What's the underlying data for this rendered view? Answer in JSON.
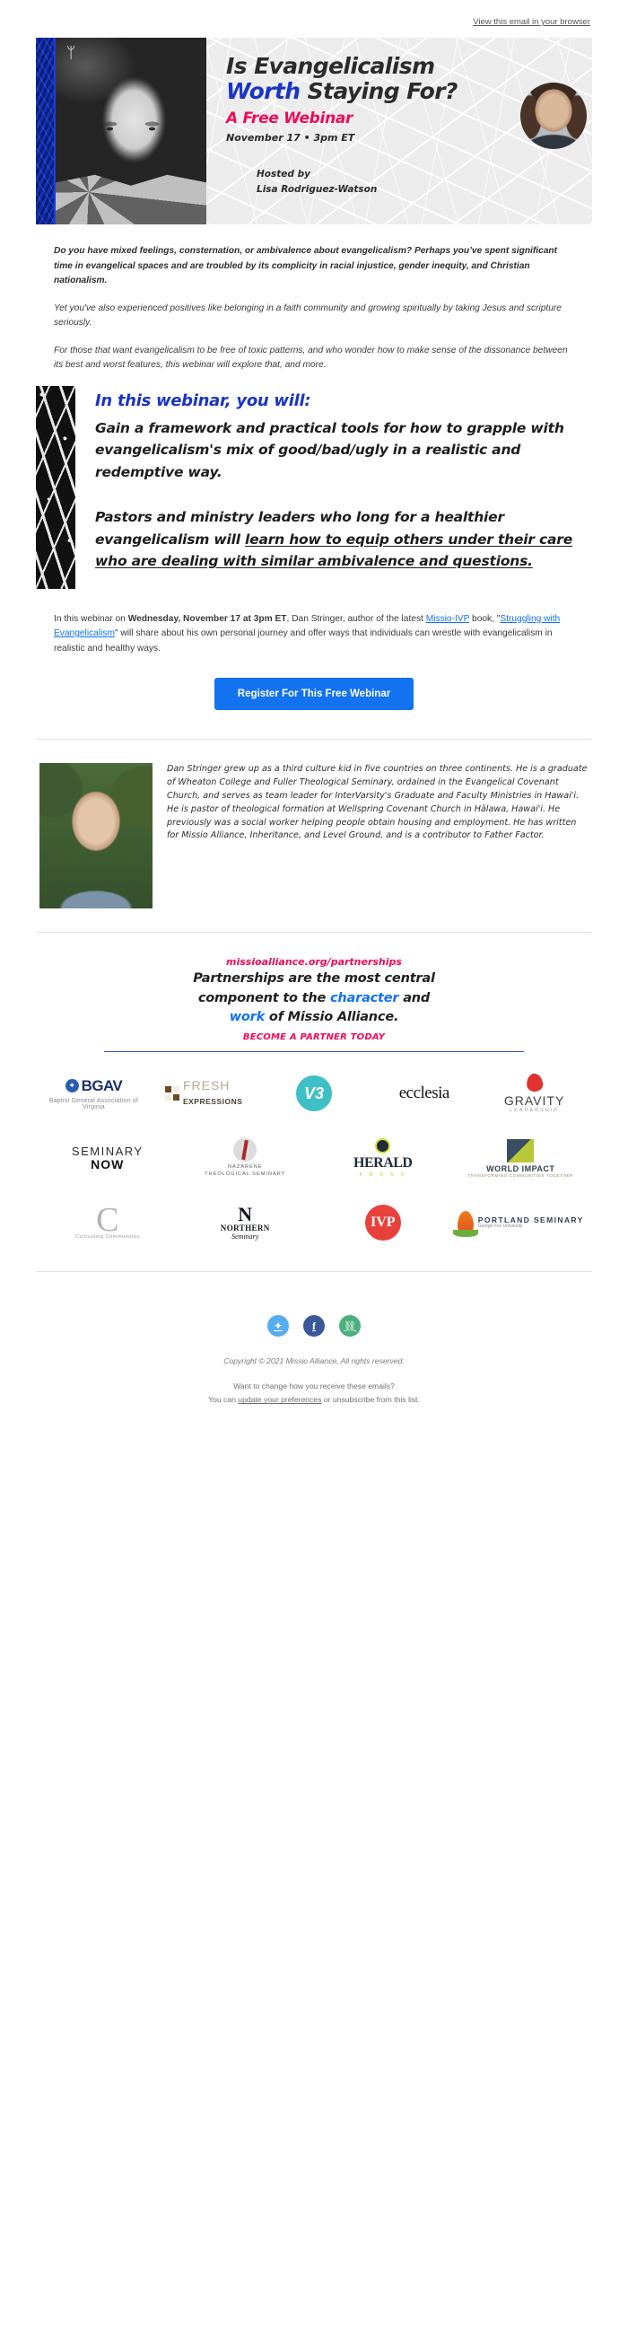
{
  "preheader": {
    "view_in_browser": "View this email in your browser"
  },
  "hero": {
    "logo_glyph": "ᛘ",
    "title_line1": "Is Evangelicalism",
    "title_worth": "Worth",
    "title_rest": " Staying For?",
    "subtitle": "A Free Webinar",
    "date": "November 17 • 3pm ET",
    "hosted_by_label": "Hosted by",
    "host_name": "Lisa Rodriguez-Watson",
    "colors": {
      "blue": "#1a35c4",
      "pink": "#ee0a5a",
      "dark": "#2b2b2b"
    }
  },
  "intro": {
    "p1": "Do you have mixed feelings, consternation, or ambivalence about evangelicalism? Perhaps you’ve spent significant time in evangelical spaces and are troubled by its complicity in racial injustice, gender inequity, and Christian nationalism.",
    "p2": "Yet you've also experienced positives like belonging in a faith community and growing spiritually by taking Jesus and scripture seriously.",
    "p3": "For those that want evangelicalism to be free of toxic patterns, and who wonder how to make sense of the dissonance between its best and worst features, this webinar will explore that, and more."
  },
  "highlight": {
    "title": "In this webinar, you will:",
    "p1": "Gain a framework and practical tools for how to grapple with evangelicalism's mix of good/bad/ugly in a realistic and redemptive way.",
    "p2_plain": "Pastors and ministry leaders who long for a healthier evangelicalism will ",
    "p2_underlined": "learn how to equip others under their care who are dealing with similar ambivalence and questions."
  },
  "register": {
    "text_before_bold": "In this webinar on ",
    "bold_date": "Wednesday, November 17 at 3pm ET",
    "text_mid1": ", Dan Stringer, author of the latest ",
    "link_missio_ivp": "Missio-IVP",
    "text_mid2": " book, \"",
    "link_book": "Struggling with Evangelicalism",
    "text_mid3": "\" will share about his own personal journey and offer ways that individuals can wrestle with evangelicalism in realistic and healthy ways.",
    "button_label": "Register For This Free Webinar"
  },
  "bio": {
    "text": "Dan Stringer grew up as a third culture kid in five countries on three continents. He is a graduate of Wheaton College and Fuller Theological Seminary, ordained in the Evangelical Covenant Church, and serves as team leader for InterVarsity's Graduate and Faculty Ministries in Hawai'i. He is pastor of theological formation at Wellspring Covenant Church in Hālawa, Hawai'i. He previously was a social worker helping people obtain housing and employment. He has written for Missio Alliance, Inheritance, and Level Ground, and is a contributor to Father Factor."
  },
  "partners": {
    "url": "missioalliance.org/partnerships",
    "tagline_1": "Partnerships are the most central",
    "tagline_2_a": "component to the ",
    "tagline_2_blue": "character",
    "tagline_2_b": " and",
    "tagline_3_blue": "work",
    "tagline_3_b": " of Missio Alliance.",
    "cta": "BECOME A PARTNER TODAY",
    "logos": [
      {
        "name": "BGAV",
        "sub": "Baptist General Association of Virginia"
      },
      {
        "name": "FRESH",
        "sub": "EXPRESSIONS"
      },
      {
        "name": "V3",
        "sub": ""
      },
      {
        "name": "ecclesia",
        "sub": ""
      },
      {
        "name": "GRAVITY",
        "sub": "LEADERSHIP"
      },
      {
        "name": "SEMINARY",
        "sub": "NOW"
      },
      {
        "name": "NAZARENE",
        "sub": "THEOLOGICAL SEMINARY"
      },
      {
        "name": "HERALD",
        "sub": "P R E S S"
      },
      {
        "name": "WORLD IMPACT",
        "sub": "TRANSFORMING COMMUNITIES TOGETHER"
      },
      {
        "name": "C",
        "sub": "Cultivating Communities"
      },
      {
        "name": "NORTHERN",
        "sub": "Seminary"
      },
      {
        "name": "IVP",
        "sub": ""
      },
      {
        "name": "PORTLAND SEMINARY",
        "sub": "George Fox University"
      }
    ]
  },
  "footer": {
    "social": [
      {
        "name": "twitter",
        "glyph": "🐦"
      },
      {
        "name": "facebook",
        "glyph": "f"
      },
      {
        "name": "link",
        "glyph": "🔗"
      }
    ],
    "copyright": "Copyright © 2021 Missio Alliance, All rights reserved.",
    "note_line1": "Want to change how you receive these emails?",
    "note_line2_a": "You can ",
    "note_line2_link": "update your preferences",
    "note_line2_b": " or unsubscribe from this list."
  }
}
